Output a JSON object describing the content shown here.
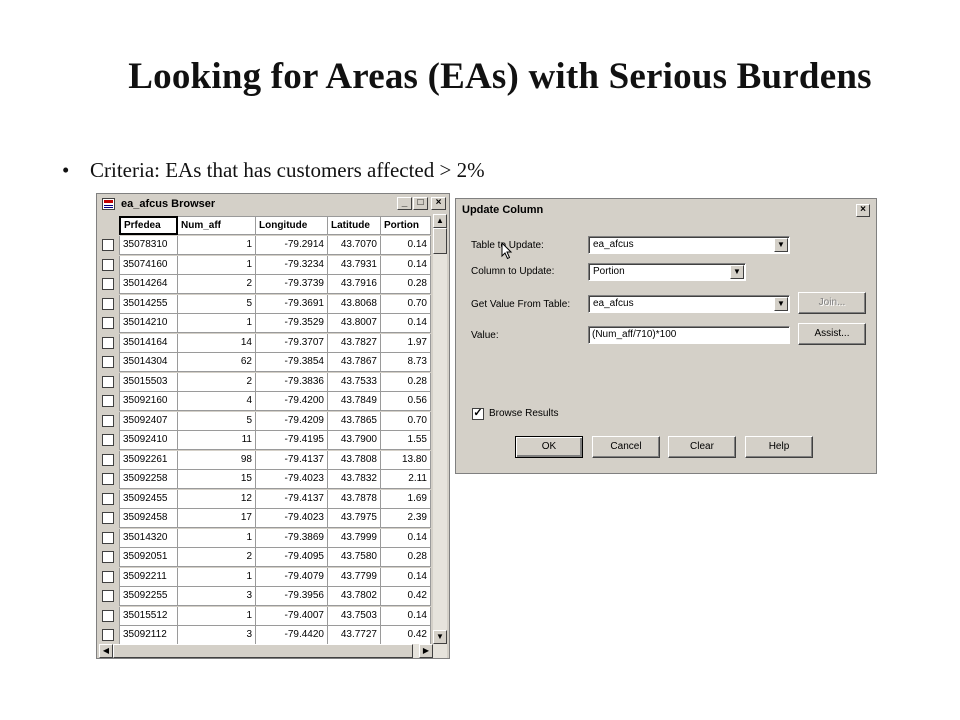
{
  "slide": {
    "title": "Looking for Areas (EAs) with Serious Burdens",
    "bullet_marker": "•",
    "bullet": "Criteria: EAs that has customers affected > 2%"
  },
  "browser": {
    "title": "ea_afcus Browser",
    "icon": "table-browser-icon",
    "minimize": "_",
    "maximize": "□",
    "close": "×",
    "columns": [
      "Prfedea",
      "Num_aff",
      "Longitude",
      "Latitude",
      "Portion"
    ],
    "rows": [
      [
        "35078310",
        "1",
        "-79.2914",
        "43.7070",
        "0.14"
      ],
      [
        "35074160",
        "1",
        "-79.3234",
        "43.7931",
        "0.14"
      ],
      [
        "35014264",
        "2",
        "-79.3739",
        "43.7916",
        "0.28"
      ],
      [
        "35014255",
        "5",
        "-79.3691",
        "43.8068",
        "0.70"
      ],
      [
        "35014210",
        "1",
        "-79.3529",
        "43.8007",
        "0.14"
      ],
      [
        "35014164",
        "14",
        "-79.3707",
        "43.7827",
        "1.97"
      ],
      [
        "35014304",
        "62",
        "-79.3854",
        "43.7867",
        "8.73"
      ],
      [
        "35015503",
        "2",
        "-79.3836",
        "43.7533",
        "0.28"
      ],
      [
        "35092160",
        "4",
        "-79.4200",
        "43.7849",
        "0.56"
      ],
      [
        "35092407",
        "5",
        "-79.4209",
        "43.7865",
        "0.70"
      ],
      [
        "35092410",
        "11",
        "-79.4195",
        "43.7900",
        "1.55"
      ],
      [
        "35092261",
        "98",
        "-79.4137",
        "43.7808",
        "13.80"
      ],
      [
        "35092258",
        "15",
        "-79.4023",
        "43.7832",
        "2.11"
      ],
      [
        "35092455",
        "12",
        "-79.4137",
        "43.7878",
        "1.69"
      ],
      [
        "35092458",
        "17",
        "-79.4023",
        "43.7975",
        "2.39"
      ],
      [
        "35014320",
        "1",
        "-79.3869",
        "43.7999",
        "0.14"
      ],
      [
        "35092051",
        "2",
        "-79.4095",
        "43.7580",
        "0.28"
      ],
      [
        "35092211",
        "1",
        "-79.4079",
        "43.7799",
        "0.14"
      ],
      [
        "35092255",
        "3",
        "-79.3956",
        "43.7802",
        "0.42"
      ],
      [
        "35015512",
        "1",
        "-79.4007",
        "43.7503",
        "0.14"
      ],
      [
        "35092112",
        "3",
        "-79.4420",
        "43.7727",
        "0.42"
      ]
    ]
  },
  "dialog": {
    "title": "Update Column",
    "close": "×",
    "table_to_update_label": "Table to Update:",
    "table_to_update_value": "ea_afcus",
    "column_to_update_label": "Column to Update:",
    "column_to_update_value": "Portion",
    "get_value_label": "Get Value From Table:",
    "get_value_value": "ea_afcus",
    "value_label": "Value:",
    "value_expression": "(Num_aff/710)*100",
    "join_button": "Join...",
    "assist_button": "Assist...",
    "browse_results_label": "Browse Results",
    "browse_results_checked": true,
    "ok_button": "OK",
    "cancel_button": "Cancel",
    "clear_button": "Clear",
    "help_button": "Help"
  },
  "glyphs": {
    "dropdown_arrow": "▼",
    "up_arrow": "▲",
    "left_arrow": "◀",
    "right_arrow": "▶",
    "check": "✓"
  }
}
